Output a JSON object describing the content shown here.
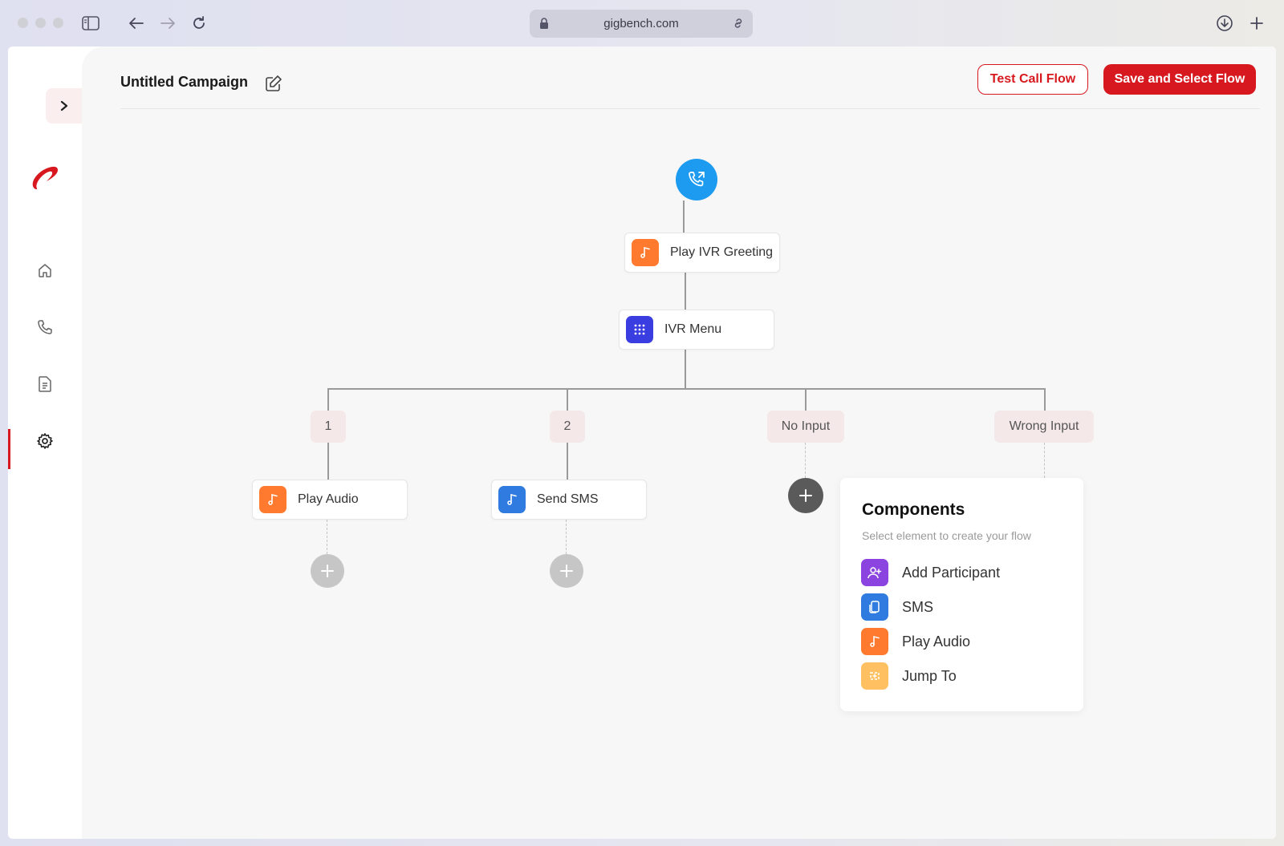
{
  "browser": {
    "url": "gigbench.com"
  },
  "header": {
    "title": "Untitled Campaign",
    "test_button": "Test Call Flow",
    "save_button": "Save and Select Flow"
  },
  "sidebar": {
    "items": [
      {
        "name": "home",
        "icon": "home-icon"
      },
      {
        "name": "calls",
        "icon": "phone-icon"
      },
      {
        "name": "documents",
        "icon": "document-icon"
      },
      {
        "name": "settings",
        "icon": "gear-icon",
        "active": true
      }
    ]
  },
  "flow": {
    "greeting": "Play IVR Greeting",
    "menu": "IVR Menu",
    "branches": [
      "1",
      "2",
      "No Input",
      "Wrong Input"
    ],
    "branch_nodes": [
      "Play Audio",
      "Send SMS"
    ]
  },
  "components": {
    "title": "Components",
    "subtitle": "Select element to create your flow",
    "items": [
      {
        "label": "Add Participant",
        "color": "#8b44e0"
      },
      {
        "label": "SMS",
        "color": "#2f7be0"
      },
      {
        "label": "Play Audio",
        "color": "#ff7a2f"
      },
      {
        "label": "Jump To",
        "color": "#ffc061"
      }
    ]
  },
  "colors": {
    "accent": "#d7191f",
    "start_node": "#1d9bf0",
    "audio": "#ff7a2f",
    "ivr_menu": "#3a3de0",
    "sms": "#2f7be0"
  }
}
